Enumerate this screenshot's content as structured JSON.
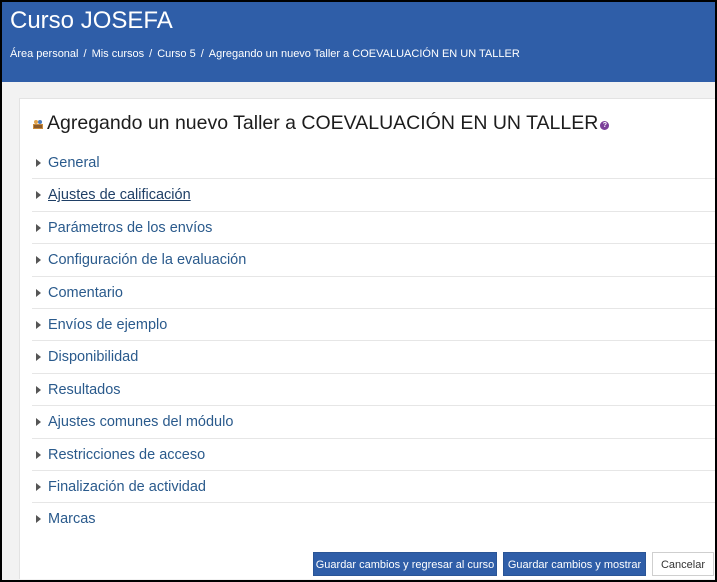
{
  "header": {
    "course_title": "Curso JOSEFA",
    "breadcrumb": [
      "Área personal",
      "Mis cursos",
      "Curso 5",
      "Agregando un nuevo Taller a COEVALUACIÓN EN UN TALLER"
    ],
    "breadcrumb_separator": "/"
  },
  "page": {
    "heading": "Agregando un nuevo Taller a COEVALUACIÓN EN UN TALLER",
    "module_icon": "workshop-icon",
    "help_icon": "question-help-icon",
    "help_glyph": "?"
  },
  "sections": [
    {
      "label": "General",
      "expanded": false
    },
    {
      "label": "Ajustes de calificación",
      "expanded": false,
      "hovered": true
    },
    {
      "label": "Parámetros de los envíos",
      "expanded": false
    },
    {
      "label": "Configuración de la evaluación",
      "expanded": false
    },
    {
      "label": "Comentario",
      "expanded": false
    },
    {
      "label": "Envíos de ejemplo",
      "expanded": false
    },
    {
      "label": "Disponibilidad",
      "expanded": false
    },
    {
      "label": "Resultados",
      "expanded": false
    },
    {
      "label": "Ajustes comunes del módulo",
      "expanded": false
    },
    {
      "label": "Restricciones de acceso",
      "expanded": false
    },
    {
      "label": "Finalización de actividad",
      "expanded": false
    },
    {
      "label": "Marcas",
      "expanded": false
    }
  ],
  "actions": {
    "save_return": "Guardar cambios y regresar al curso",
    "save_display": "Guardar cambios y mostrar",
    "cancel": "Cancelar"
  },
  "colors": {
    "brand": "#2f5ea8",
    "link": "#2a5a8c",
    "help": "#7b3f99"
  }
}
